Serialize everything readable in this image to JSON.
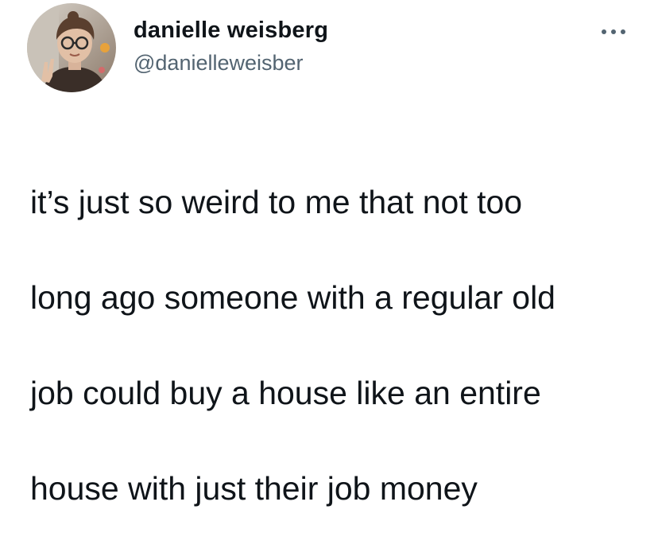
{
  "tweet": {
    "author": {
      "display_name": "danielle weisberg",
      "handle": "@danielleweisber",
      "avatar_icon": "profile-photo"
    },
    "menu_icon": "more-options-icon",
    "text_lines": [
      "it’s just so weird to me that not too",
      "long ago someone with a regular old",
      "job could buy a house like an entire",
      "house with just their job money"
    ]
  },
  "colors": {
    "text_primary": "#0f1419",
    "text_secondary": "#536471",
    "background": "#ffffff"
  }
}
